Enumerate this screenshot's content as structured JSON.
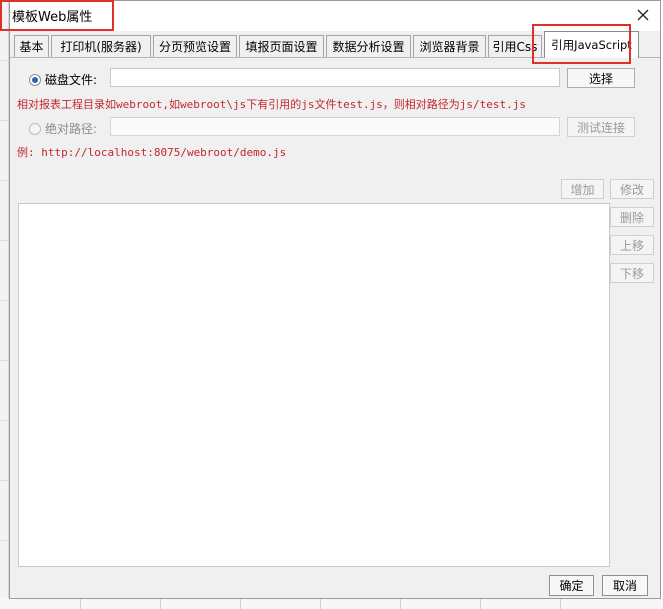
{
  "window": {
    "title": "模板Web属性"
  },
  "tabs": [
    {
      "label": "基本"
    },
    {
      "label": "打印机(服务器)"
    },
    {
      "label": "分页预览设置"
    },
    {
      "label": "填报页面设置"
    },
    {
      "label": "数据分析设置"
    },
    {
      "label": "浏览器背景"
    },
    {
      "label": "引用Css"
    },
    {
      "label": "引用JavaScript",
      "active": true
    }
  ],
  "disk_file": {
    "radio_label": "磁盘文件:",
    "selected": true,
    "value": "",
    "choose_button": "选择"
  },
  "hint_relative": "相对报表工程目录如webroot,如webroot\\js下有引用的js文件test.js，则相对路径为js/test.js",
  "absolute_path": {
    "radio_label": "绝对路径:",
    "selected": false,
    "enabled": false,
    "value": "",
    "test_button": "测试连接"
  },
  "hint_example": "例: http://localhost:8075/webroot/demo.js",
  "list_buttons": {
    "add": "增加",
    "modify": "修改",
    "delete": "删除",
    "move_up": "上移",
    "move_down": "下移"
  },
  "list_items": [],
  "footer": {
    "ok": "确定",
    "cancel": "取消"
  },
  "colors": {
    "highlight": "#e0302a",
    "hint_text": "#c1282d",
    "radio_accent": "#2d64b3"
  }
}
